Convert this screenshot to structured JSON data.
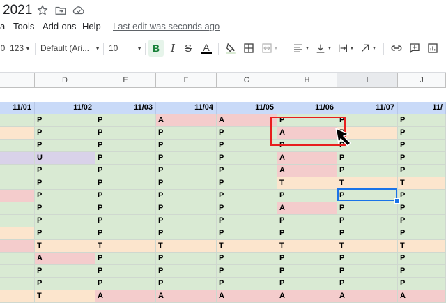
{
  "title": {
    "text": "2021"
  },
  "menu": {
    "items": [
      "a",
      "Tools",
      "Add-ons",
      "Help"
    ],
    "last_edit": "Last edit was seconds ago"
  },
  "toolbar": {
    "zoom_partial": "0",
    "format_more": "123",
    "font": "Default (Ari...",
    "font_size": "10",
    "bold": "B",
    "italic": "I",
    "strike": "S",
    "text_color_letter": "A"
  },
  "columns": [
    "D",
    "E",
    "F",
    "G",
    "H",
    "I",
    "J"
  ],
  "dates": [
    "11/01",
    "11/02",
    "11/03",
    "11/04",
    "11/05",
    "11/06",
    "11/07",
    "11/"
  ],
  "rows": [
    [
      "P",
      "P",
      "A",
      "A",
      "P",
      "P",
      "P"
    ],
    [
      "P",
      "P",
      "P",
      "P",
      "A",
      "P",
      "P"
    ],
    [
      "P",
      "P",
      "P",
      "P",
      "P",
      "P",
      "P"
    ],
    [
      "U",
      "P",
      "P",
      "P",
      "A",
      "P",
      "P"
    ],
    [
      "P",
      "P",
      "P",
      "P",
      "A",
      "P",
      "P"
    ],
    [
      "P",
      "P",
      "P",
      "P",
      "T",
      "T",
      "T"
    ],
    [
      "P",
      "P",
      "P",
      "P",
      "P",
      "P",
      "P"
    ],
    [
      "P",
      "P",
      "P",
      "P",
      "A",
      "P",
      "P"
    ],
    [
      "P",
      "P",
      "P",
      "P",
      "P",
      "P",
      "P"
    ],
    [
      "P",
      "P",
      "P",
      "P",
      "P",
      "P",
      "P"
    ],
    [
      "T",
      "T",
      "T",
      "T",
      "T",
      "T",
      "T"
    ],
    [
      "A",
      "P",
      "P",
      "P",
      "P",
      "P",
      "P"
    ],
    [
      "P",
      "P",
      "P",
      "P",
      "P",
      "P",
      "P"
    ],
    [
      "P",
      "P",
      "P",
      "P",
      "P",
      "P",
      "P"
    ],
    [
      "T",
      "A",
      "A",
      "A",
      "A",
      "A",
      "A"
    ]
  ],
  "left_col_colors": [
    "green",
    "orange",
    "green",
    "purple",
    "green",
    "green",
    "red",
    "green",
    "green",
    "orange",
    "red",
    "green",
    "green",
    "green",
    "orange"
  ],
  "colors": {
    "green": "#d9ead3",
    "red": "#f4cccc",
    "orange": "#fce5cd",
    "purple": "#d9d2e9",
    "header_blue": "#c9daf8",
    "selection": "#1a73e8",
    "highlight_box": "#e81e1e"
  }
}
